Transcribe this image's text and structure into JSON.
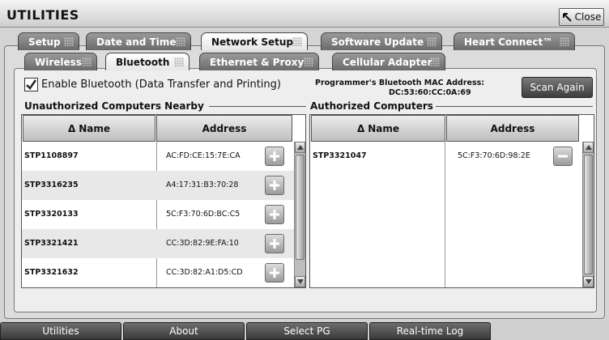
{
  "title": "UTILITIES",
  "close_label": "Close",
  "main_tabs": [
    {
      "label": "Setup",
      "active": false
    },
    {
      "label": "Date and Time",
      "active": false
    },
    {
      "label": "Network Setup",
      "active": true
    },
    {
      "label": "Software Update",
      "active": false
    },
    {
      "label": "Heart Connect™",
      "active": false
    }
  ],
  "sub_tabs": [
    {
      "label": "Wireless",
      "active": false
    },
    {
      "label": "Bluetooth",
      "active": true
    },
    {
      "label": "Ethernet & Proxy",
      "active": false
    },
    {
      "label": "Cellular Adapter",
      "active": false
    }
  ],
  "bluetooth": {
    "enable_label": "Enable Bluetooth (Data Transfer and Printing)",
    "enable_checked": true,
    "mac_label": "Programmer's Bluetooth MAC Address:",
    "mac_value": "DC:53:60:CC:0A:69",
    "scan_label": "Scan Again"
  },
  "unauthorized": {
    "title": "Unauthorized Computers Nearby",
    "col_name": "Name",
    "col_address": "Address",
    "sort_icon": "delta-sort-icon",
    "rows": [
      {
        "name": "STP1108897",
        "address": "AC:FD:CE:15:7E:CA"
      },
      {
        "name": "STP3316235",
        "address": "A4:17:31:B3:70:28"
      },
      {
        "name": "STP3320133",
        "address": "5C:F3:70:6D:BC:C5"
      },
      {
        "name": "STP3321421",
        "address": "CC:3D:82:9E:FA:10"
      },
      {
        "name": "STP3321632",
        "address": "CC:3D:82:A1:D5:CD"
      }
    ]
  },
  "authorized": {
    "title": "Authorized Computers",
    "col_name": "Name",
    "col_address": "Address",
    "rows": [
      {
        "name": "STP3321047",
        "address": "5C:F3:70:6D:98:2E"
      }
    ]
  },
  "bottom_nav": [
    {
      "label": "Utilities"
    },
    {
      "label": "About"
    },
    {
      "label": "Select PG"
    },
    {
      "label": "Real-time Log"
    }
  ],
  "colors": {
    "tab_active": "#ffffff",
    "tab_inactive": "#7a7a7a",
    "button_dark": "#4a4a4a"
  }
}
